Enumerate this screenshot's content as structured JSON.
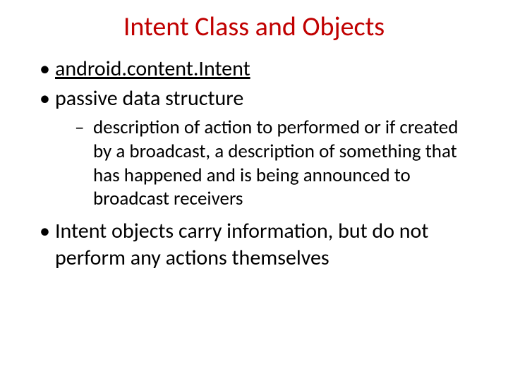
{
  "title": "Intent Class and Objects",
  "bullets": {
    "item0": "android.content.Intent",
    "item1": "passive data structure",
    "sub0": "description of action to performed or if created by a broadcast, a description of something that has happened and is being announced to broadcast receivers",
    "item2": "Intent objects carry information, but do not perform any actions themselves"
  }
}
